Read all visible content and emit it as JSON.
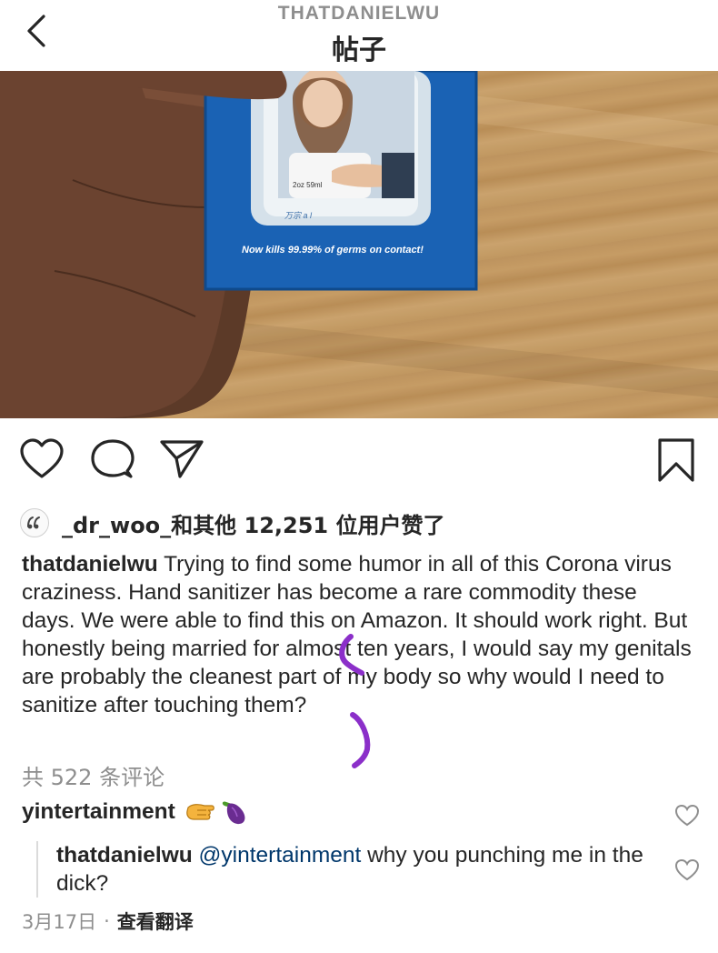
{
  "header": {
    "username": "THATDANIELWU",
    "title": "帖子"
  },
  "photo": {
    "product_text": "Now kills 99.99% of germs on contact!",
    "bottle_label": "2oz 59ml"
  },
  "likes": {
    "text": "_dr_woo_和其他 12,251 位用户赞了"
  },
  "caption": {
    "username": "thatdanielwu",
    "text": " Trying to find some humor in all of this Corona virus craziness. Hand sanitizer has become a rare commodity these days. We were able to find this on Amazon. It should work right. But honestly being married for almost ten years, I would say my genitals are probably the cleanest part of my body so why would I need to sanitize after touching them?"
  },
  "view_comments": "共 522 条评论",
  "comments": [
    {
      "username": "yintertainment",
      "emojis": [
        "fist-emoji",
        "eggplant-emoji"
      ]
    }
  ],
  "reply": {
    "username": "thatdanielwu",
    "mention": "@yintertainment",
    "text": " why you punching me in the dick?"
  },
  "meta": {
    "date": "3月17日",
    "separator": "·",
    "translate": "查看翻译"
  },
  "colors": {
    "text": "#262626",
    "secondary": "#8e8e8e",
    "mention": "#00376b",
    "annotation": "#8b2fc9"
  }
}
